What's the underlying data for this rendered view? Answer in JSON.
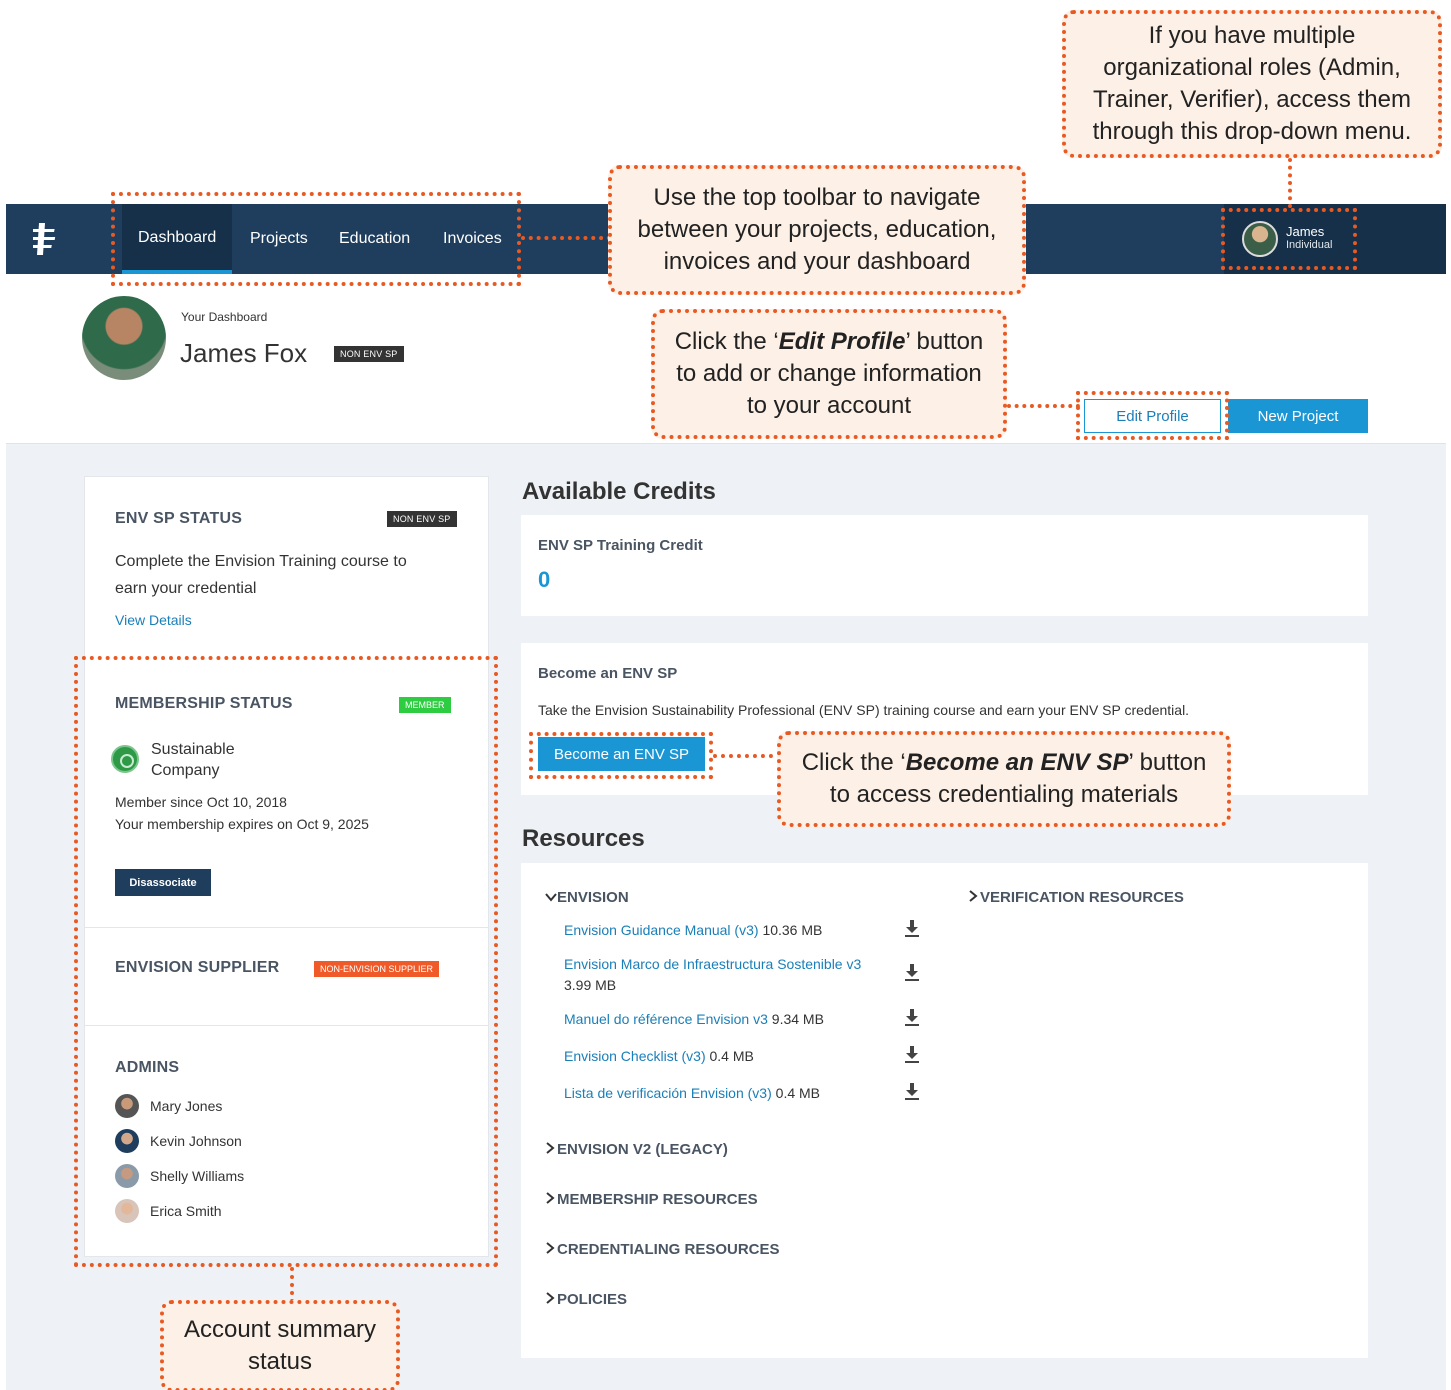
{
  "nav": {
    "items": [
      "Dashboard",
      "Projects",
      "Education",
      "Invoices"
    ],
    "user_name": "James",
    "user_role": "Individual"
  },
  "header": {
    "subtitle": "Your Dashboard",
    "name": "James Fox",
    "badge": "NON ENV SP",
    "edit_button": "Edit Profile",
    "new_button": "New Project"
  },
  "left": {
    "envsp": {
      "title": "ENV SP STATUS",
      "badge": "NON ENV SP",
      "text": "Complete the Envision Training course to earn your credential",
      "link": "View Details"
    },
    "membership": {
      "title": "MEMBERSHIP STATUS",
      "badge": "MEMBER",
      "company": "Sustainable Company",
      "since": "Member since Oct 10, 2018",
      "expires": "Your membership expires on Oct 9, 2025",
      "button": "Disassociate"
    },
    "supplier": {
      "title": "ENVISION SUPPLIER",
      "badge": "NON-ENVISION SUPPLIER"
    },
    "admins": {
      "title": "ADMINS",
      "list": [
        "Mary Jones",
        "Kevin Johnson",
        "Shelly Williams",
        "Erica Smith"
      ]
    }
  },
  "credits": {
    "heading": "Available Credits",
    "label": "ENV SP Training Credit",
    "value": "0"
  },
  "become": {
    "title": "Become an ENV SP",
    "description": "Take the Envision Sustainability Professional (ENV SP) training course and earn your ENV SP credential.",
    "button": "Become an ENV SP"
  },
  "resources": {
    "heading": "Resources",
    "envision_section": "ENVISION",
    "verification_section": "VERIFICATION RESOURCES",
    "files": [
      {
        "name": "Envision Guidance Manual (v3)",
        "size": "10.36 MB"
      },
      {
        "name": "Envision Marco de Infraestructura Sostenible v3",
        "size": "3.99 MB"
      },
      {
        "name": "Manuel do référence Envision v3",
        "size": "9.34 MB"
      },
      {
        "name": "Envision Checklist (v3)",
        "size": "0.4 MB"
      },
      {
        "name": "Lista de verificación Envision (v3)",
        "size": "0.4 MB"
      }
    ],
    "collapsed": [
      "ENVISION V2 (LEGACY)",
      "MEMBERSHIP RESOURCES",
      "CREDENTIALING RESOURCES",
      "POLICIES"
    ]
  },
  "callouts": {
    "roles": "If you have multiple organizational roles (Admin, Trainer, Verifier), access them through this drop-down menu.",
    "toolbar": "Use the top toolbar to navigate between your projects, education, invoices and your dashboard",
    "edit_pre": "Click the ‘",
    "edit_em": "Edit Profile",
    "edit_post": "’ button to add or change information to your account",
    "become_pre": "Click the ‘",
    "become_em": "Become an ENV SP",
    "become_post": "’ button to access credentialing materials",
    "summary": "Account summary status"
  },
  "colors": {
    "nav": "#1f3e5e",
    "accent": "#1a96d4",
    "annotation": "#e85a24",
    "member_badge": "#2ecc40",
    "supplier_badge": "#f05a28"
  }
}
